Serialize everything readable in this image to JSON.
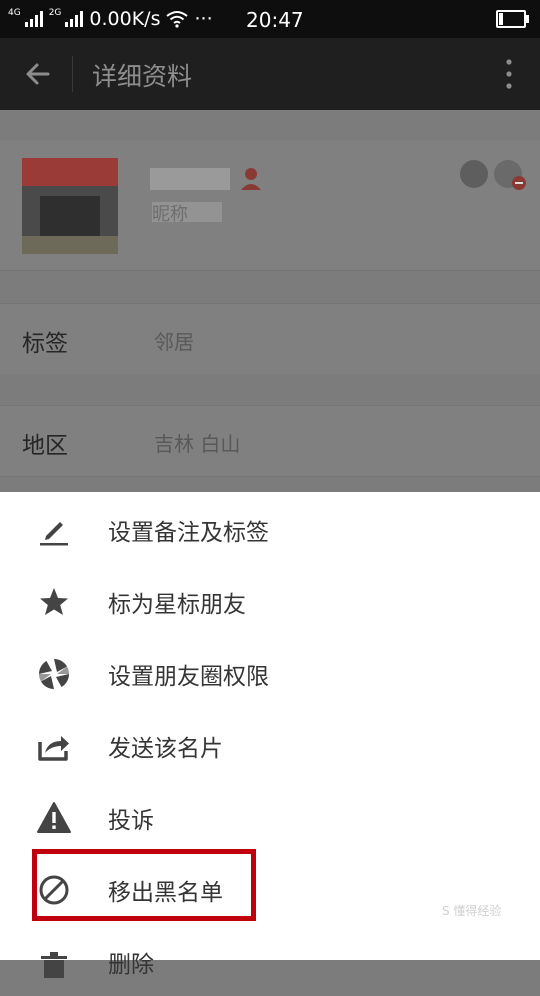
{
  "status_bar": {
    "network_1": "4G",
    "network_2": "2G",
    "speed": "0.00K/s",
    "dots": "···",
    "time": "20:47",
    "battery_level": 0.18
  },
  "header": {
    "back_icon": "arrow-left-icon",
    "title": "详细资料",
    "more_icon": "more-vertical-icon"
  },
  "profile": {
    "nickname_label": "昵称"
  },
  "fields": [
    {
      "label": "标签",
      "value": "邻居"
    },
    {
      "label": "地区",
      "value": "吉林  白山"
    }
  ],
  "menu": [
    {
      "icon": "edit-icon",
      "label": "设置备注及标签"
    },
    {
      "icon": "star-icon",
      "label": "标为星标朋友"
    },
    {
      "icon": "moments-icon",
      "label": "设置朋友圈权限"
    },
    {
      "icon": "share-icon",
      "label": "发送该名片"
    },
    {
      "icon": "warning-icon",
      "label": "投诉"
    },
    {
      "icon": "block-icon",
      "label": "移出黑名单"
    },
    {
      "icon": "trash-icon",
      "label": "删除"
    }
  ],
  "highlight_color": "#c0000c",
  "watermark": "S 懂得经验"
}
